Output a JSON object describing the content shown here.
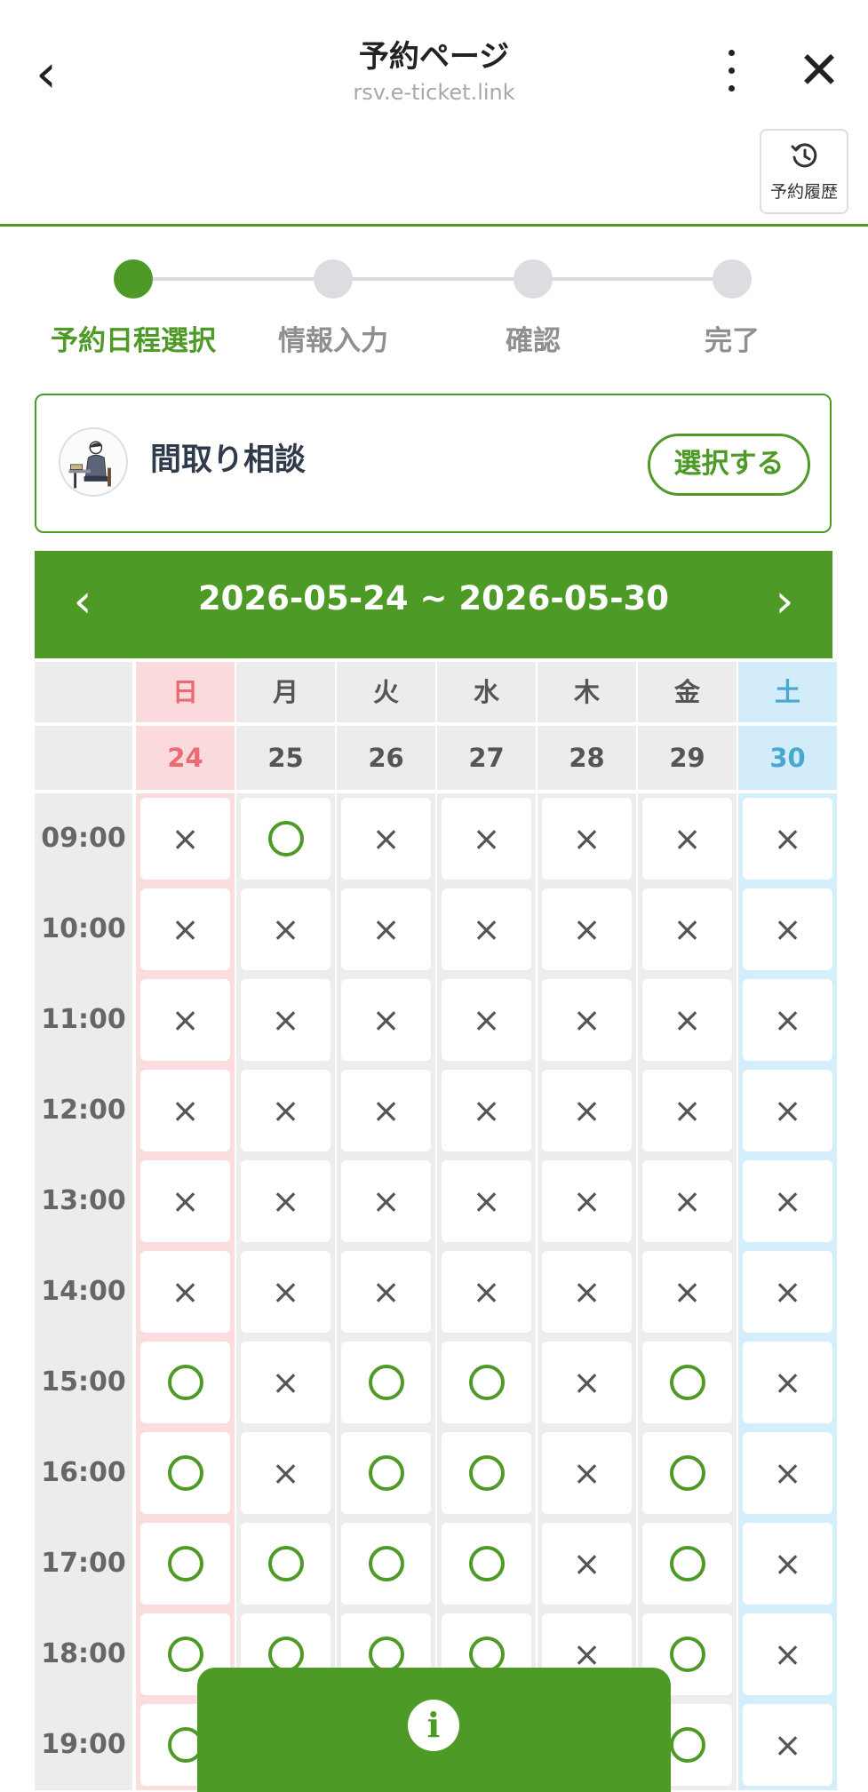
{
  "header": {
    "back_label": "‹",
    "title": "予約ページ",
    "url": "rsv.e-ticket.link",
    "close_label": "✕",
    "history_label": "予約履歴"
  },
  "stepper": {
    "steps": [
      {
        "label": "予約日程選択",
        "active": true
      },
      {
        "label": "情報入力",
        "active": false
      },
      {
        "label": "確認",
        "active": false
      },
      {
        "label": "完了",
        "active": false
      }
    ]
  },
  "service": {
    "name": "間取り相談",
    "select_label": "選択する"
  },
  "week": {
    "prev_label": "‹",
    "range": "2026-05-24 ~ 2026-05-30",
    "next_label": "›"
  },
  "calendar": {
    "days": [
      {
        "dow": "日",
        "date": "24",
        "type": "sun"
      },
      {
        "dow": "月",
        "date": "25",
        "type": "weekday"
      },
      {
        "dow": "火",
        "date": "26",
        "type": "weekday"
      },
      {
        "dow": "水",
        "date": "27",
        "type": "weekday"
      },
      {
        "dow": "木",
        "date": "28",
        "type": "weekday"
      },
      {
        "dow": "金",
        "date": "29",
        "type": "weekday"
      },
      {
        "dow": "土",
        "date": "30",
        "type": "sat"
      }
    ],
    "unavailable_symbol": "×",
    "rows": [
      {
        "time": "09:00",
        "slots": [
          false,
          true,
          false,
          false,
          false,
          false,
          false
        ]
      },
      {
        "time": "10:00",
        "slots": [
          false,
          false,
          false,
          false,
          false,
          false,
          false
        ]
      },
      {
        "time": "11:00",
        "slots": [
          false,
          false,
          false,
          false,
          false,
          false,
          false
        ]
      },
      {
        "time": "12:00",
        "slots": [
          false,
          false,
          false,
          false,
          false,
          false,
          false
        ]
      },
      {
        "time": "13:00",
        "slots": [
          false,
          false,
          false,
          false,
          false,
          false,
          false
        ]
      },
      {
        "time": "14:00",
        "slots": [
          false,
          false,
          false,
          false,
          false,
          false,
          false
        ]
      },
      {
        "time": "15:00",
        "slots": [
          true,
          false,
          true,
          true,
          false,
          true,
          false
        ]
      },
      {
        "time": "16:00",
        "slots": [
          true,
          false,
          true,
          true,
          false,
          true,
          false
        ]
      },
      {
        "time": "17:00",
        "slots": [
          true,
          true,
          true,
          true,
          false,
          true,
          false
        ]
      },
      {
        "time": "18:00",
        "slots": [
          true,
          true,
          true,
          true,
          false,
          true,
          false
        ]
      },
      {
        "time": "19:00",
        "slots": [
          true,
          true,
          true,
          true,
          false,
          true,
          false
        ]
      }
    ]
  },
  "info_button": {
    "icon": "i"
  },
  "colors": {
    "accent": "#4e9a26",
    "sunday": "#ec6b72",
    "saturday": "#47a9cf"
  }
}
